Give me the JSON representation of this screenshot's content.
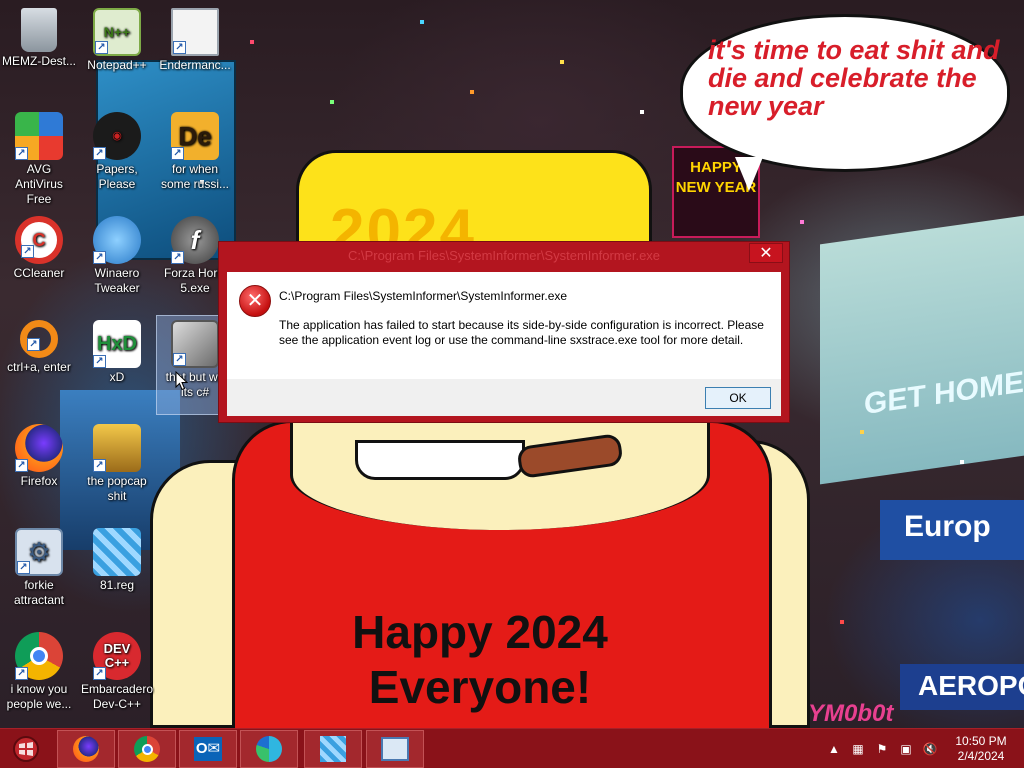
{
  "wallpaper": {
    "speech_text": "it's time to eat shit and die and celebrate the new year",
    "hat_year": "2024",
    "shirt_text_line1": "Happy 2024",
    "shirt_text_line2": "Everyone!",
    "billboard_happy": "HAPPY NEW YEAR",
    "billboard_get_home": "GET HOME",
    "billboard_europ": "Europ",
    "billboard_aerop": "AEROPOS",
    "watermark": "YM0b0t"
  },
  "desktop_icons": [
    {
      "label": "MEMZ-Dest...",
      "icon": "recycle-bin-icon"
    },
    {
      "label": "Notepad++",
      "icon": "notepad-plus-plus-icon"
    },
    {
      "label": "Endermanc...",
      "icon": "window-app-icon"
    },
    {
      "label": "AVG AntiVirus Free",
      "icon": "avg-antivirus-icon"
    },
    {
      "label": "Papers, Please",
      "icon": "papers-please-icon"
    },
    {
      "label": "for when some russi...",
      "icon": "de-icon"
    },
    {
      "label": "CCleaner",
      "icon": "ccleaner-icon"
    },
    {
      "label": "Winaero Tweaker",
      "icon": "winaero-tweaker-icon"
    },
    {
      "label": "Forza Horiz 5.exe",
      "icon": "flash-icon"
    },
    {
      "label": "ctrl+a, enter",
      "icon": "orange-ring-icon"
    },
    {
      "label": "xD",
      "icon": "hxd-icon"
    },
    {
      "label": "that but wh its c#",
      "icon": "stacked-windows-icon"
    },
    {
      "label": "Firefox",
      "icon": "firefox-icon"
    },
    {
      "label": "the popcap shit",
      "icon": "popcap-icon"
    },
    {
      "label": "forkie attractant",
      "icon": "gear-settings-icon"
    },
    {
      "label": "81.reg",
      "icon": "registry-file-icon"
    },
    {
      "label": "i know you people we...",
      "icon": "chrome-icon"
    },
    {
      "label": "Embarcadero Dev-C++",
      "icon": "dev-cpp-icon"
    }
  ],
  "dialog": {
    "title": "C:\\Program Files\\SystemInformer\\SystemInformer.exe",
    "close_label": "✕",
    "path": "C:\\Program Files\\SystemInformer\\SystemInformer.exe",
    "message": "The application has failed to start because its side-by-side configuration is incorrect. Please see the application event log or use the command-line sxstrace.exe tool for more detail.",
    "ok_label": "OK"
  },
  "taskbar": {
    "pinned": [
      "firefox-icon",
      "chrome-icon",
      "outlook-icon",
      "edge-icon",
      "registry-editor-icon",
      "control-panel-icon"
    ],
    "clock_time": "10:50 PM",
    "clock_date": "2/4/2024"
  },
  "colors": {
    "taskbar": "#8a1219",
    "dialog_frame": "#b3151f",
    "speech_text": "#d81e2a",
    "shirt": "#e41b17",
    "hat": "#fde21a"
  }
}
